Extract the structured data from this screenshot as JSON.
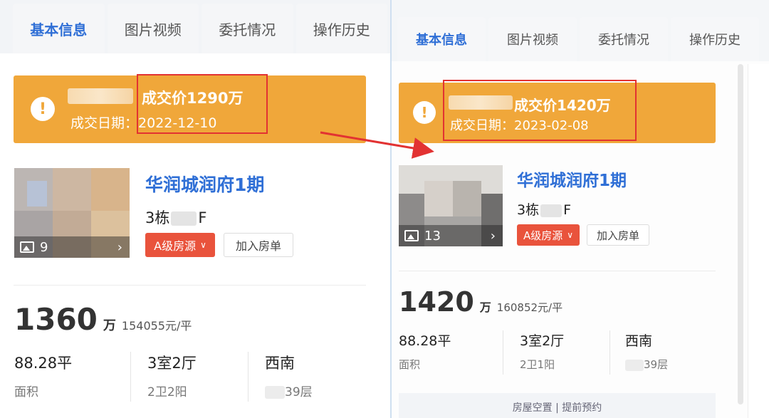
{
  "left": {
    "tabs": [
      "基本信息",
      "图片视频",
      "委托情况",
      "操作历史"
    ],
    "active_tab": 0,
    "deal": {
      "price_text": "成交价1290万",
      "date_label": "成交日期：",
      "date": "2022-12-10"
    },
    "photos": {
      "count": "9"
    },
    "estate_name": "华润城润府1期",
    "unit_prefix": "3栋",
    "unit_suffix": "F",
    "grade_label": "A级房源",
    "add_label": "加入房单",
    "price": {
      "total": "1360",
      "unit": "万",
      "unit_price": "154055元/平"
    },
    "attrs": [
      {
        "value": "88.28平",
        "label": "面积"
      },
      {
        "value": "3室2厅",
        "label": "2卫2阳"
      },
      {
        "value": "西南",
        "label": "39层"
      }
    ]
  },
  "right": {
    "tabs": [
      "基本信息",
      "图片视频",
      "委托情况",
      "操作历史"
    ],
    "active_tab": 0,
    "deal": {
      "price_text": "成交价1420万",
      "date_label": "成交日期：",
      "date": "2023-02-08"
    },
    "photos": {
      "count": "13"
    },
    "estate_name": "华润城润府1期",
    "unit_prefix": "3栋",
    "unit_suffix": "F",
    "grade_label": "A级房源",
    "add_label": "加入房单",
    "price": {
      "total": "1420",
      "unit": "万",
      "unit_price": "160852元/平"
    },
    "attrs": [
      {
        "value": "88.28平",
        "label": "面积"
      },
      {
        "value": "3室2厅",
        "label": "2卫1阳"
      },
      {
        "value": "西南",
        "label": "39层"
      }
    ],
    "notice": "房屋空置  |  提前预约"
  },
  "colors": {
    "accent": "#2f6fd6",
    "banner": "#f0a73a",
    "grade": "#e9533c",
    "highlight": "#e23232"
  }
}
